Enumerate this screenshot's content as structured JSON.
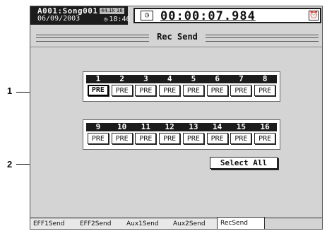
{
  "header": {
    "song_name": "A001:Song001",
    "date": "06/09/2003",
    "badge": "44.1k 16",
    "time_icon": "clock-icon",
    "time": "18:46",
    "counter": "00:00:07.984",
    "counter_left_icon": "timer-icon",
    "counter_right_icon": "alarm-clock-icon"
  },
  "page": {
    "title": "Rec Send"
  },
  "grid1": {
    "numbers": [
      "1",
      "2",
      "3",
      "4",
      "5",
      "6",
      "7",
      "8"
    ],
    "buttons": [
      "PRE",
      "PRE",
      "PRE",
      "PRE",
      "PRE",
      "PRE",
      "PRE",
      "PRE"
    ]
  },
  "grid2": {
    "numbers": [
      "9",
      "10",
      "11",
      "12",
      "13",
      "14",
      "15",
      "16"
    ],
    "buttons": [
      "PRE",
      "PRE",
      "PRE",
      "PRE",
      "PRE",
      "PRE",
      "PRE",
      "PRE"
    ]
  },
  "select_all": "Select All",
  "tabs": [
    "EFF1Send",
    "EFF2Send",
    "Aux1Send",
    "Aux2Send",
    "RecSend"
  ],
  "active_tab": "RecSend",
  "callouts": [
    "1",
    "2"
  ],
  "colors": {
    "screen_bg": "#d4d4d4",
    "dark": "#1c1c1c",
    "light": "#ffffff"
  }
}
